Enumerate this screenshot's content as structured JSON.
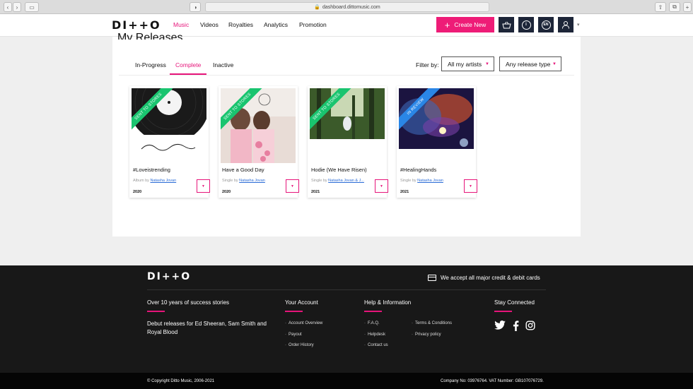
{
  "browser": {
    "url": "dashboard.dittomusic.com"
  },
  "header": {
    "logo": "DI++O",
    "nav": [
      "Music",
      "Videos",
      "Royalties",
      "Analytics",
      "Promotion"
    ],
    "active_nav": "Music",
    "create_label": "Create New",
    "lang_badge": "EN",
    "accent": "#ee1c77",
    "icon_bg": "#1d2538"
  },
  "page": {
    "title_partial": "My Releases",
    "tabs": [
      "In-Progress",
      "Complete",
      "Inactive"
    ],
    "active_tab": "Complete",
    "filter_label": "Filter by:",
    "filter_artist": "All my artists",
    "filter_type": "Any release type"
  },
  "releases": [
    {
      "title": "#Loveistrending",
      "type": "Album by",
      "artist": "Natasha Jovan",
      "year": "2020",
      "status": "SENT TO STORES",
      "status_color": "#19c46f"
    },
    {
      "title": "Have a Good Day",
      "type": "Single by",
      "artist": "Natasha Jovan",
      "year": "2020",
      "status": "SENT TO STORES",
      "status_color": "#19c46f"
    },
    {
      "title": "Hodie (We Have Risen)",
      "type": "Single by",
      "artist": "Natasha Jovan & J...",
      "year": "2021",
      "status": "SENT TO STORES",
      "status_color": "#19c46f"
    },
    {
      "title": "#HealingHands",
      "type": "Single by",
      "artist": "Natasha Jovan",
      "year": "2021",
      "status": "IN REVIEW",
      "status_color": "#2a86e6"
    }
  ],
  "footer": {
    "logo": "DI++O",
    "cards_text": "We accept all major credit & debit cards",
    "col1_head": "Over 10 years of success stories",
    "col1_body": "Debut releases for Ed Sheeran, Sam Smith and Royal Blood",
    "col2_head": "Your Account",
    "col2_links": [
      "Account Overview",
      "Payout",
      "Order History"
    ],
    "col3_head": "Help & Information",
    "col3_links_a": [
      "F.A.Q.",
      "Helpdesk",
      "Contact us"
    ],
    "col3_links_b": [
      "Terms & Conditions",
      "Privacy policy"
    ],
    "col4_head": "Stay Connected",
    "copyright": "© Copyright Ditto Music, 2006-2021",
    "company": "Company No: 03976764. VAT Number: GB107076729."
  }
}
